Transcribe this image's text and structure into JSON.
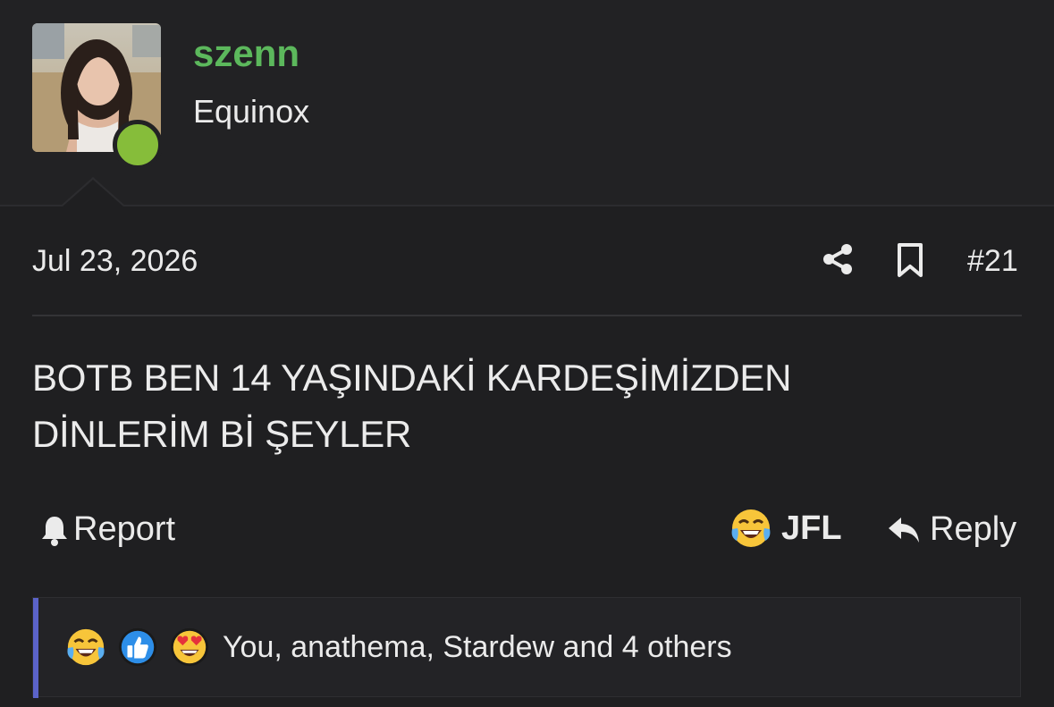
{
  "header": {
    "username": "szenn",
    "user_title": "Equinox"
  },
  "post": {
    "date": "Jul 23, 2026",
    "post_number": "#21",
    "message_line1": "BOTB BEN 14 YAŞINDAKİ KARDEŞİMİZDEN",
    "message_line2": "DİNLERİM Bİ ŞEYLER"
  },
  "actions": {
    "report_label": "Report",
    "reaction_label": "JFL",
    "reply_label": "Reply"
  },
  "reactions": {
    "summary": "You, anathema, Stardew and 4 others",
    "icons": [
      "laughing-crying-emoji",
      "thumbs-up-emoji",
      "heart-eyes-emoji"
    ]
  },
  "colors": {
    "username": "#5cb85c",
    "online_status": "#86bd3a",
    "reactions_accent": "#5b63c9",
    "background": "#1f1f21"
  }
}
